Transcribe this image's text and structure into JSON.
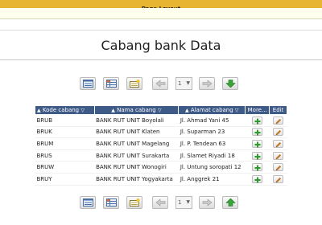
{
  "app": {
    "banner": "Page Layout"
  },
  "page": {
    "title": "Cabang bank Data"
  },
  "toolbar": {
    "pager_value": "1",
    "pager_arrow": "▼",
    "buttons": [
      "list-view-icon",
      "grid-view-icon",
      "new-record-icon",
      "prev-page-icon",
      "next-page-icon",
      "download-icon"
    ]
  },
  "table": {
    "columns": [
      {
        "sort": "▲",
        "label": "Kode cabang",
        "filter": "▽"
      },
      {
        "sort": "▲",
        "label": "Nama cabang",
        "filter": "▽"
      },
      {
        "sort": "▲",
        "label": "Alamat cabang",
        "filter": "▽"
      },
      {
        "label": "More..."
      },
      {
        "label": "Edit"
      }
    ],
    "rows": [
      {
        "kode": "BRUB",
        "nama": "BANK RUT UNIT Boyolali",
        "alamat": "Jl. Ahmad Yani 45"
      },
      {
        "kode": "BRUK",
        "nama": "BANK RUT UNIT Klaten",
        "alamat": "Jl. Suparman 23"
      },
      {
        "kode": "BRUM",
        "nama": "BANK RUT UNIT Magelang",
        "alamat": "Jl. P. Tendean 63"
      },
      {
        "kode": "BRUS",
        "nama": "BANK RUT UNIT Surakarta",
        "alamat": "Jl. Slamet Riyadi 18"
      },
      {
        "kode": "BRUW",
        "nama": "BANK RUT UNIT Wonogiri",
        "alamat": "Jl. Untung soropati 12"
      },
      {
        "kode": "BRUY",
        "nama": "BANK RUT UNIT Yogyakarta",
        "alamat": "Jl. Anggrek 21"
      }
    ]
  },
  "colors": {
    "header_bg": "#3e5a86",
    "banner_bg": "#e8b533",
    "add_green": "#2e9a2e",
    "edit_orange": "#d0781c",
    "nav_green": "#3aa33a"
  }
}
